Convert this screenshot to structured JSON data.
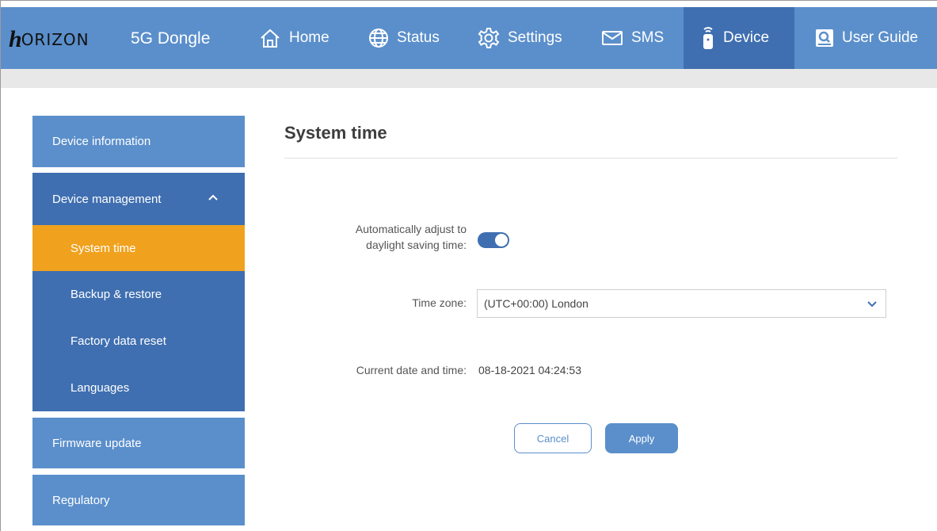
{
  "header": {
    "logo_mark": "h",
    "logo_text": "ORIZON",
    "product": "5G Dongle",
    "nav": [
      {
        "label": "Home",
        "icon": "home-icon"
      },
      {
        "label": "Status",
        "icon": "globe-icon"
      },
      {
        "label": "Settings",
        "icon": "gear-icon"
      },
      {
        "label": "SMS",
        "icon": "envelope-icon"
      },
      {
        "label": "Device",
        "icon": "device-icon",
        "active": true
      },
      {
        "label": "User Guide",
        "icon": "guide-icon"
      }
    ]
  },
  "sidebar": {
    "device_information": "Device information",
    "device_management": "Device management",
    "sub_items": [
      "System time",
      "Backup & restore",
      "Factory data reset",
      "Languages"
    ],
    "active_sub_item": "System time",
    "firmware_update": "Firmware update",
    "regulatory": "Regulatory"
  },
  "main": {
    "title": "System time",
    "dst_label_line1": "Automatically adjust to",
    "dst_label_line2": "daylight saving time:",
    "dst_enabled": true,
    "timezone_label": "Time zone:",
    "timezone_value": "(UTC+00:00) London",
    "datetime_label": "Current date and time:",
    "datetime_value": "08-18-2021 04:24:53",
    "cancel_label": "Cancel",
    "apply_label": "Apply"
  },
  "colors": {
    "primary": "#5b8fcb",
    "primary_dark": "#3f6fb0",
    "active_accent": "#f0a21e"
  }
}
